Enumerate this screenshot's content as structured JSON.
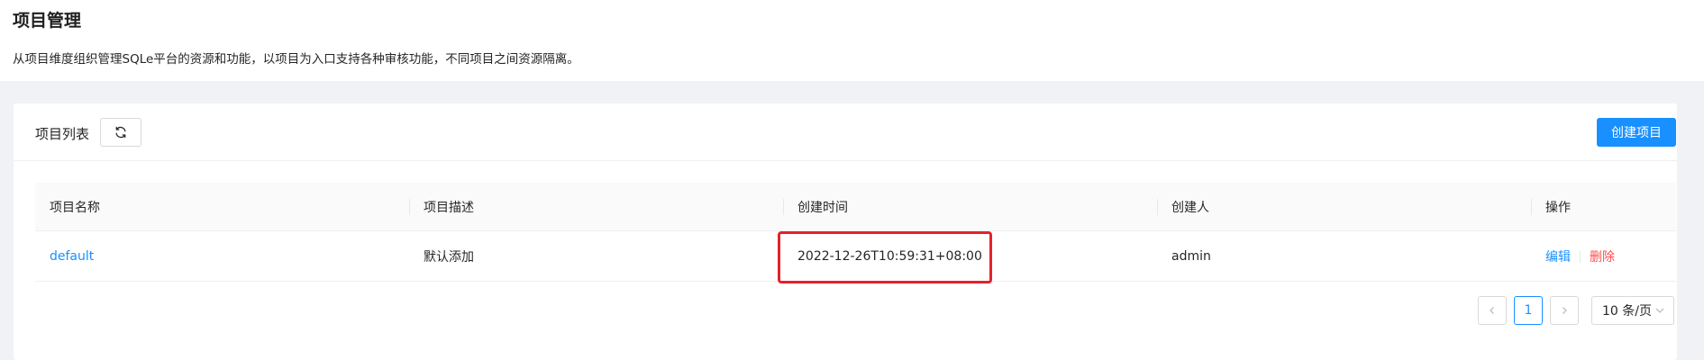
{
  "header": {
    "title": "项目管理",
    "description": "从项目维度组织管理SQLe平台的资源和功能，以项目为入口支持各种审核功能，不同项目之间资源隔离。"
  },
  "card": {
    "title": "项目列表",
    "refresh_icon": "refresh-icon",
    "create_label": "创建项目"
  },
  "table": {
    "columns": [
      "项目名称",
      "项目描述",
      "创建时间",
      "创建人",
      "操作"
    ],
    "rows": [
      {
        "name": "default",
        "description": "默认添加",
        "created_at": "2022-12-26T10:59:31+08:00",
        "creator": "admin",
        "edit_label": "编辑",
        "delete_label": "删除"
      }
    ]
  },
  "pagination": {
    "prev_icon": "chevron-left-icon",
    "current_page": "1",
    "next_icon": "chevron-right-icon",
    "page_size": "10 条/页"
  },
  "colors": {
    "primary": "#1890ff",
    "danger": "#ff4d4f",
    "highlight": "#e5222a"
  }
}
